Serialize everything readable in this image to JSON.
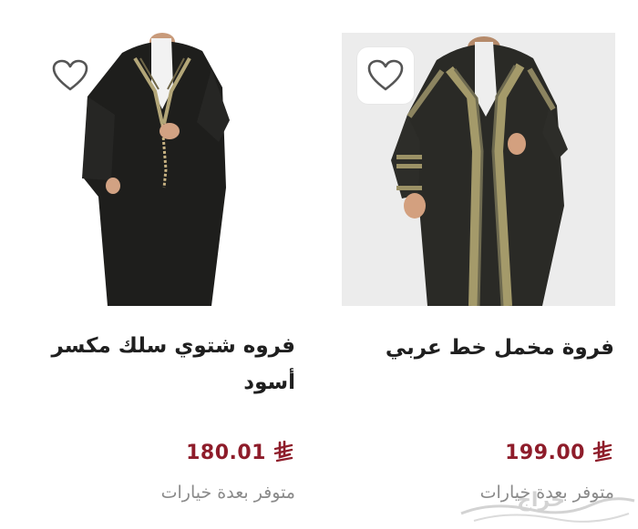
{
  "products": [
    {
      "title": "فروة مخمل خط عربي",
      "price": "199.00",
      "availability": "متوفر بعدة خيارات",
      "image_icon": "product-photo-velvet-farwa",
      "wishlist_icon": "heart-icon"
    },
    {
      "title": "فروه شتوي سلك مكسر أسود",
      "price": "180.01",
      "availability": "متوفر بعدة خيارات",
      "image_icon": "product-photo-black-farwa",
      "wishlist_icon": "heart-icon"
    }
  ],
  "colors": {
    "price": "#8e1c2a",
    "title": "#1f1f1f",
    "muted": "#8a8a8a",
    "image_bg": "#ececec"
  },
  "watermark": "حراج"
}
